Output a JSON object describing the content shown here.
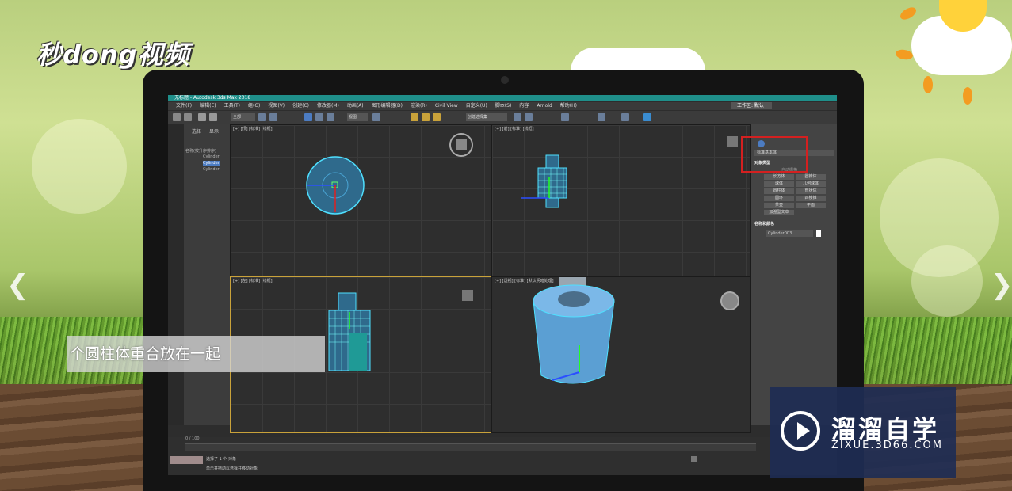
{
  "brand_left": "秒dong视频",
  "window": {
    "title": "无标题 - Autodesk 3ds Max 2018",
    "workspace": "工作区: 默认"
  },
  "menu": [
    "文件(F)",
    "编辑(E)",
    "工具(T)",
    "组(G)",
    "视图(V)",
    "创建(C)",
    "修改器(M)",
    "动画(A)",
    "图形编辑器(D)",
    "渲染(R)",
    "Civil View",
    "自定义(U)",
    "脚本(S)",
    "内容",
    "Arnold",
    "帮助(H)"
  ],
  "toolbar": {
    "filter": "全部",
    "view": "视图",
    "selset": "创建选择集"
  },
  "scene_explorer": {
    "tabs": [
      "选择",
      "显示"
    ],
    "header": "名称(按升序排序)",
    "items": [
      "Cylinder",
      "Cylinder",
      "Cylinder"
    ]
  },
  "viewports": {
    "top": "[+] [顶] [标准] [线框]",
    "front": "[+] [前] [标准] [线框]",
    "left": "[+] [左] [标准] [线框]",
    "persp": "[+] [透视] [标准] [默认明暗处理]"
  },
  "command_panel": {
    "category": "标准基本体",
    "object_type": "对象类型",
    "autogrid": "自动栅格",
    "buttons": [
      "长方体",
      "圆锥体",
      "球体",
      "几何球体",
      "圆柱体",
      "管状体",
      "圆环",
      "四棱锥",
      "茶壶",
      "平面",
      "加强型文本"
    ],
    "name_color": "名称和颜色",
    "name_value": "Cylinder003"
  },
  "status": {
    "sel": "选择了 1 个 对象",
    "hint": "单击并拖动以选择并移动对象",
    "frames": "0 / 100"
  },
  "caption": "个圆柱体重合放在一起",
  "watermark": {
    "title": "溜溜自学",
    "url": "ZIXUE.3D66.COM"
  }
}
